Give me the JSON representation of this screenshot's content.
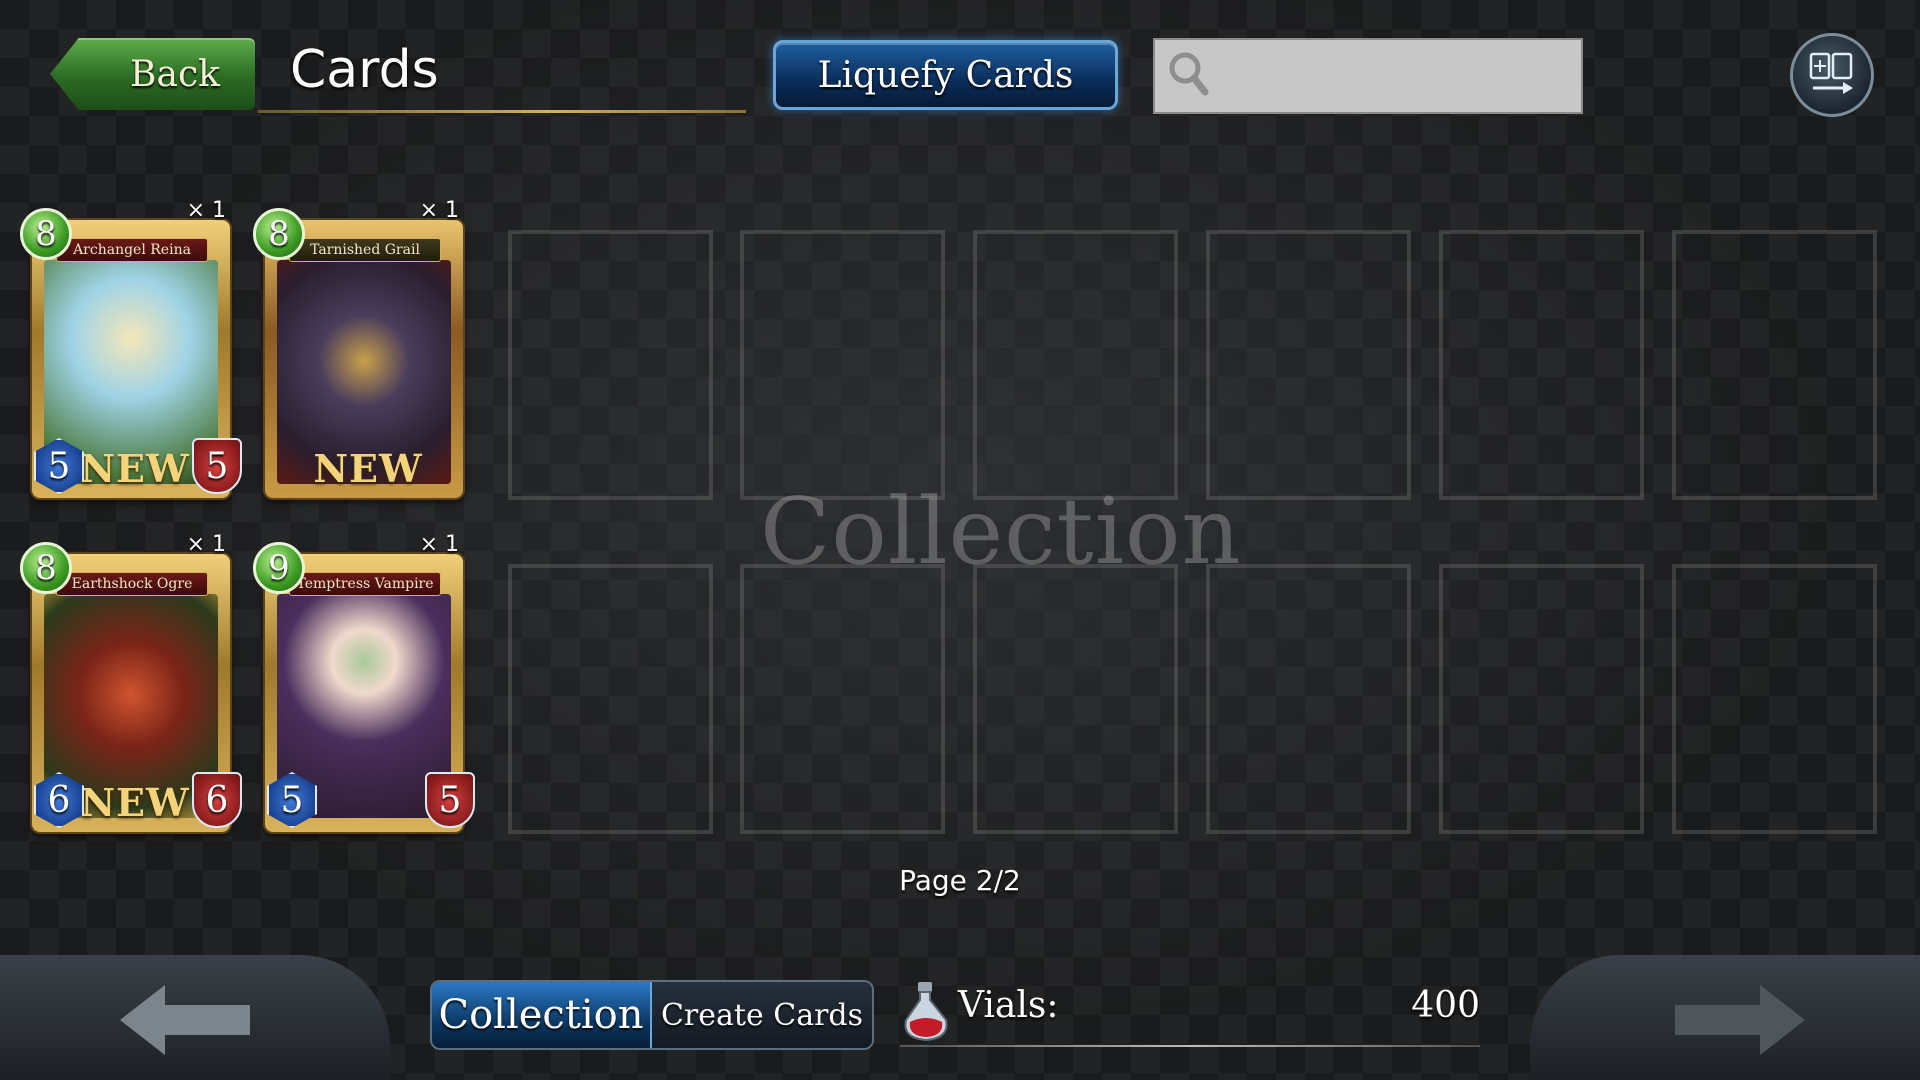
{
  "header": {
    "back_label": "Back",
    "title": "Cards",
    "liquefy_label": "Liquefy Cards",
    "search": {
      "value": "",
      "placeholder": ""
    }
  },
  "collection": {
    "watermark": "Collection",
    "cards": [
      {
        "name": "Archangel Reina",
        "cost": "8",
        "count": "× 1",
        "attack": "5",
        "defense": "5",
        "is_new": true,
        "new_label": "NEW",
        "art_colors": [
          "#9fd3e6",
          "#e8d79a",
          "#4c7a3e"
        ]
      },
      {
        "name": "Tarnished Grail",
        "cost": "8",
        "count": "× 1",
        "attack": "",
        "defense": "",
        "is_new": true,
        "new_label": "NEW",
        "art_colors": [
          "#4a3d5c",
          "#2a1e2e",
          "#9a2c1e"
        ]
      },
      {
        "name": "Earthshock Ogre",
        "cost": "8",
        "count": "× 1",
        "attack": "6",
        "defense": "6",
        "is_new": true,
        "new_label": "NEW",
        "art_colors": [
          "#7a2418",
          "#2b3a1c",
          "#c7a13c"
        ]
      },
      {
        "name": "Temptress Vampire",
        "cost": "9",
        "count": "× 1",
        "attack": "5",
        "defense": "5",
        "is_new": false,
        "new_label": "",
        "art_colors": [
          "#4a2e5c",
          "#a9c89a",
          "#2a1a2c"
        ]
      }
    ],
    "page": "Page 2/2"
  },
  "footer": {
    "tabs": [
      {
        "label": "Collection",
        "active": true
      },
      {
        "label": "Create Cards",
        "active": false
      }
    ],
    "vials_label": "Vials:",
    "vials_value": "400"
  },
  "icons": {
    "back": "arrow-left-icon",
    "search": "search-icon",
    "deck": "deck-switch-icon",
    "prev": "arrow-left-icon",
    "next": "arrow-right-icon",
    "vial": "vial-potion-icon"
  },
  "colors": {
    "back_button": "#3a8a2e",
    "liquefy_button": "#0f3f78",
    "cost_gem": "#3c9a22",
    "attack_gem": "#1f4fb0",
    "defense_gem": "#a01e20",
    "card_frame": "#c9a24a"
  }
}
